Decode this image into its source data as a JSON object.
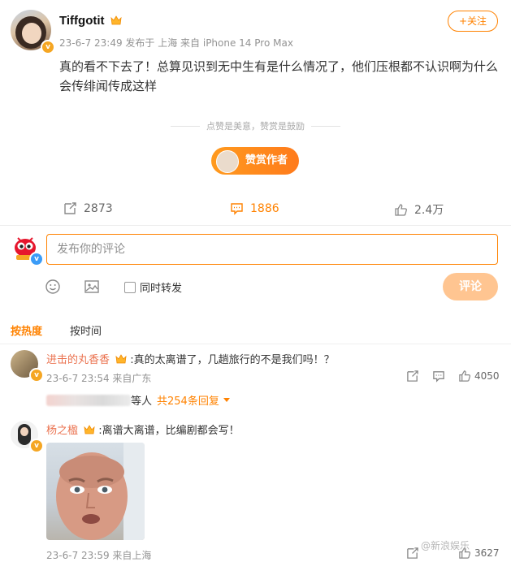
{
  "post": {
    "username": "Tiffgotit",
    "meta": "23-6-7 23:49  发布于 上海  来自 iPhone 14 Pro Max",
    "follow_label": "+关注",
    "text": "真的看不下去了！总算见识到无中生有是什么情况了，他们压根都不认识啊为什么会传绯闻传成这样",
    "reward_note": "点赞是美意，赞赏是鼓励",
    "reward_button": "赞赏作者"
  },
  "stats": {
    "repost": "2873",
    "comments": "1886",
    "likes": "2.4万"
  },
  "composer": {
    "placeholder": "发布你的评论",
    "repost_label": "同时转发",
    "submit_label": "评论"
  },
  "sort": {
    "hot": "按热度",
    "time": "按时间"
  },
  "comments": [
    {
      "user": "进击的丸香香",
      "text": ":真的太离谱了，几趟旅行的不是我们吗！？",
      "meta": "23-6-7 23:54  来自广东",
      "likes": "4050",
      "reply_suffix": "等人",
      "reply_count": "共254条回复"
    },
    {
      "user": "杨之楹",
      "text": ":离谱大离谱，比编剧都会写！",
      "meta": "23-6-7 23:59  来自上海",
      "likes": "3627"
    }
  ],
  "watermark": "@新浪娱乐",
  "colors": {
    "accent": "#ff8200",
    "username_link": "#eb7350",
    "submit_disabled": "#ffc591"
  }
}
